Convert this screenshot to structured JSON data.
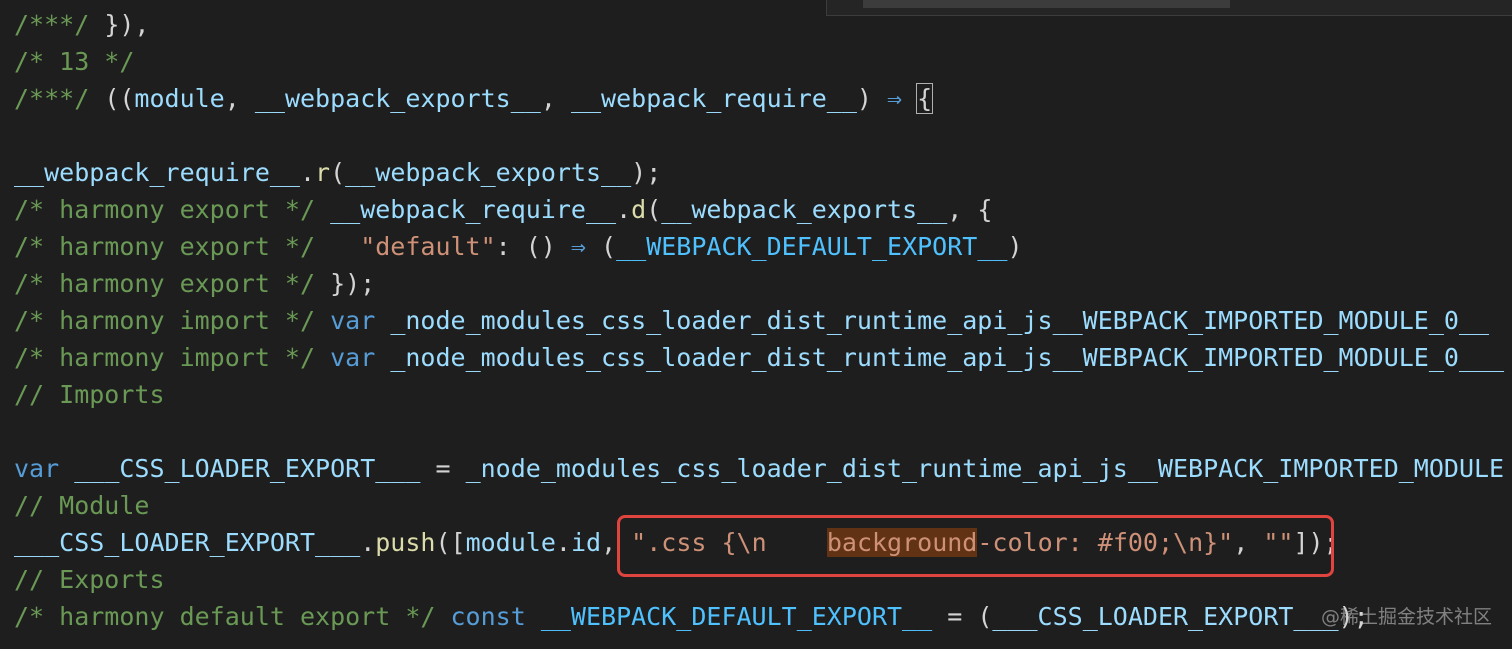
{
  "lines": [
    {
      "tokens": [
        {
          "t": "/***/",
          "c": "c"
        },
        {
          "t": " }),",
          "c": "p"
        }
      ]
    },
    {
      "tokens": [
        {
          "t": "/* 13 */",
          "c": "c"
        }
      ]
    },
    {
      "tokens": [
        {
          "t": "/***/",
          "c": "c"
        },
        {
          "t": " ((",
          "c": "p"
        },
        {
          "t": "module",
          "c": "v"
        },
        {
          "t": ", ",
          "c": "p"
        },
        {
          "t": "__webpack_exports__",
          "c": "v"
        },
        {
          "t": ", ",
          "c": "p"
        },
        {
          "t": "__webpack_require__",
          "c": "v"
        },
        {
          "t": ") ",
          "c": "p"
        },
        {
          "t": "⇒",
          "c": "arrow"
        },
        {
          "t": " ",
          "c": "p"
        },
        {
          "t": "{",
          "c": "p",
          "box": true
        }
      ]
    },
    {
      "tokens": []
    },
    {
      "tokens": [
        {
          "t": "__webpack_require__",
          "c": "v"
        },
        {
          "t": ".",
          "c": "p"
        },
        {
          "t": "r",
          "c": "f"
        },
        {
          "t": "(",
          "c": "p"
        },
        {
          "t": "__webpack_exports__",
          "c": "v"
        },
        {
          "t": ");",
          "c": "p"
        }
      ]
    },
    {
      "tokens": [
        {
          "t": "/* harmony export */",
          "c": "c"
        },
        {
          "t": " ",
          "c": "p"
        },
        {
          "t": "__webpack_require__",
          "c": "v"
        },
        {
          "t": ".",
          "c": "p"
        },
        {
          "t": "d",
          "c": "f"
        },
        {
          "t": "(",
          "c": "p"
        },
        {
          "t": "__webpack_exports__",
          "c": "v"
        },
        {
          "t": ", {",
          "c": "p"
        }
      ]
    },
    {
      "tokens": [
        {
          "t": "/* harmony export */",
          "c": "c"
        },
        {
          "t": "   ",
          "c": "p"
        },
        {
          "t": "\"default\"",
          "c": "s"
        },
        {
          "t": ": () ",
          "c": "p"
        },
        {
          "t": "⇒",
          "c": "arrow"
        },
        {
          "t": " (",
          "c": "p"
        },
        {
          "t": "__WEBPACK_DEFAULT_EXPORT__",
          "c": "cn"
        },
        {
          "t": ")",
          "c": "p"
        }
      ]
    },
    {
      "tokens": [
        {
          "t": "/* harmony export */",
          "c": "c"
        },
        {
          "t": " });",
          "c": "p"
        }
      ]
    },
    {
      "tokens": [
        {
          "t": "/* harmony import */",
          "c": "c"
        },
        {
          "t": " ",
          "c": "p"
        },
        {
          "t": "var",
          "c": "k"
        },
        {
          "t": " ",
          "c": "p"
        },
        {
          "t": "_node_modules_css_loader_dist_runtime_api_js__WEBPACK_IMPORTED_MODULE_0__",
          "c": "v"
        }
      ]
    },
    {
      "tokens": [
        {
          "t": "/* harmony import */",
          "c": "c"
        },
        {
          "t": " ",
          "c": "p"
        },
        {
          "t": "var",
          "c": "k"
        },
        {
          "t": " ",
          "c": "p"
        },
        {
          "t": "_node_modules_css_loader_dist_runtime_api_js__WEBPACK_IMPORTED_MODULE_0___",
          "c": "v"
        }
      ]
    },
    {
      "tokens": [
        {
          "t": "// Imports",
          "c": "c"
        }
      ]
    },
    {
      "tokens": []
    },
    {
      "tokens": [
        {
          "t": "var",
          "c": "k"
        },
        {
          "t": " ",
          "c": "p"
        },
        {
          "t": "___CSS_LOADER_EXPORT___",
          "c": "v"
        },
        {
          "t": " = ",
          "c": "p"
        },
        {
          "t": "_node_modules_css_loader_dist_runtime_api_js__WEBPACK_IMPORTED_MODULE",
          "c": "v"
        }
      ]
    },
    {
      "tokens": [
        {
          "t": "// Module",
          "c": "c"
        }
      ]
    },
    {
      "tokens": [
        {
          "t": "___CSS_LOADER_EXPORT___",
          "c": "v"
        },
        {
          "t": ".",
          "c": "p"
        },
        {
          "t": "push",
          "c": "f"
        },
        {
          "t": "([",
          "c": "p"
        },
        {
          "t": "module",
          "c": "v"
        },
        {
          "t": ".",
          "c": "p"
        },
        {
          "t": "id",
          "c": "v"
        },
        {
          "t": ", ",
          "c": "p"
        },
        {
          "t": "\".css {\\n    ",
          "c": "s"
        },
        {
          "t": "background",
          "c": "s",
          "hl": true
        },
        {
          "t": "-color: #f00;\\n}\"",
          "c": "s"
        },
        {
          "t": ", ",
          "c": "p"
        },
        {
          "t": "\"\"",
          "c": "s"
        },
        {
          "t": "]);",
          "c": "p"
        }
      ]
    },
    {
      "tokens": [
        {
          "t": "// Exports",
          "c": "c"
        }
      ]
    },
    {
      "tokens": [
        {
          "t": "/* harmony default export */",
          "c": "c"
        },
        {
          "t": " ",
          "c": "p"
        },
        {
          "t": "const",
          "c": "k"
        },
        {
          "t": " ",
          "c": "p"
        },
        {
          "t": "__WEBPACK_DEFAULT_EXPORT__",
          "c": "cn"
        },
        {
          "t": " = (",
          "c": "p"
        },
        {
          "t": "___CSS_LOADER_EXPORT___",
          "c": "v"
        },
        {
          "t": ");",
          "c": "p"
        }
      ]
    }
  ],
  "watermark": "@稀土掘金技术社区"
}
